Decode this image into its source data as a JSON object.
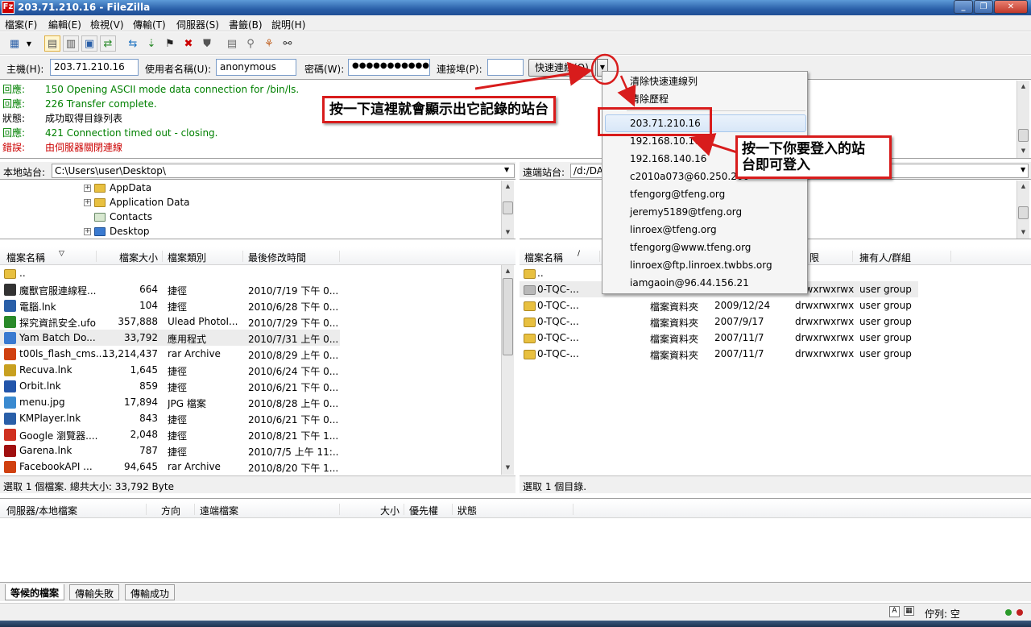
{
  "window": {
    "title": "203.71.210.16 - FileZilla",
    "app_icon": "Fz"
  },
  "menu": [
    "檔案(F)",
    "編輯(E)",
    "檢視(V)",
    "傳輸(T)",
    "伺服器(S)",
    "書籤(B)",
    "說明(H)"
  ],
  "quickconnect": {
    "host_label": "主機(H):",
    "host": "203.71.210.16",
    "user_label": "使用者名稱(U):",
    "user": "anonymous",
    "pass_label": "密碼(W):",
    "pass": "●●●●●●●●●●●●●",
    "port_label": "連接埠(P):",
    "port": "",
    "button": "快速連線(Q)"
  },
  "log": [
    {
      "type": "回應:",
      "msg": "150 Opening ASCII mode data connection for /bin/ls.",
      "color": "#008000"
    },
    {
      "type": "回應:",
      "msg": "226 Transfer complete.",
      "color": "#008000"
    },
    {
      "type": "狀態:",
      "msg": "成功取得目錄列表",
      "color": "#000000"
    },
    {
      "type": "回應:",
      "msg": "421 Connection timed out - closing.",
      "color": "#008000"
    },
    {
      "type": "錯誤:",
      "msg": "由伺服器關閉連線",
      "color": "#cc0000"
    }
  ],
  "local": {
    "label": "本地站台:",
    "path": "C:\\Users\\user\\Desktop\\",
    "tree": [
      "AppData",
      "Application Data",
      "Contacts",
      "Desktop"
    ],
    "columns": [
      "檔案名稱",
      "檔案大小",
      "檔案類別",
      "最後修改時間"
    ],
    "files": [
      {
        "name": "..",
        "size": "",
        "type": "",
        "date": ""
      },
      {
        "name": "魔獸官服連線程...",
        "size": "664",
        "type": "捷徑",
        "date": "2010/7/19 下午 0..."
      },
      {
        "name": "電腦.lnk",
        "size": "104",
        "type": "捷徑",
        "date": "2010/6/28 下午 0..."
      },
      {
        "name": "探究資訊安全.ufo",
        "size": "357,888",
        "type": "Ulead PhotoI...",
        "date": "2010/7/29 下午 0..."
      },
      {
        "name": "Yam Batch Do...",
        "size": "33,792",
        "type": "應用程式",
        "date": "2010/7/31 上午 0..."
      },
      {
        "name": "t00ls_flash_cms....",
        "size": "13,214,437",
        "type": "rar Archive",
        "date": "2010/8/29 上午 0..."
      },
      {
        "name": "Recuva.lnk",
        "size": "1,645",
        "type": "捷徑",
        "date": "2010/6/24 下午 0..."
      },
      {
        "name": "Orbit.lnk",
        "size": "859",
        "type": "捷徑",
        "date": "2010/6/21 下午 0..."
      },
      {
        "name": "menu.jpg",
        "size": "17,894",
        "type": "JPG 檔案",
        "date": "2010/8/28 上午 0..."
      },
      {
        "name": "KMPlayer.lnk",
        "size": "843",
        "type": "捷徑",
        "date": "2010/6/21 下午 0..."
      },
      {
        "name": "Google 瀏覽器....",
        "size": "2,048",
        "type": "捷徑",
        "date": "2010/8/21 下午 1..."
      },
      {
        "name": "Garena.lnk",
        "size": "787",
        "type": "捷徑",
        "date": "2010/7/5 上午 11:..."
      },
      {
        "name": "FacebookAPI ...",
        "size": "94,645",
        "type": "rar Archive",
        "date": "2010/8/20 下午 1..."
      }
    ],
    "status": "選取 1 個檔案. 總共大小: 33,792 Byte"
  },
  "remote": {
    "label": "遠端站台:",
    "path": "/d:/DA",
    "columns": [
      "檔案名稱",
      "",
      "",
      "限",
      "擁有人/群組"
    ],
    "files": [
      {
        "name": "..",
        "type": "",
        "date": "",
        "perm": "",
        "owner": ""
      },
      {
        "name": "0-TQC-...",
        "type": "",
        "date": "",
        "perm": "drwxrwxrwx",
        "owner": "user group"
      },
      {
        "name": "0-TQC-...",
        "type": "檔案資料夾",
        "date": "2009/12/24",
        "perm": "drwxrwxrwx",
        "owner": "user group"
      },
      {
        "name": "0-TQC-...",
        "type": "檔案資料夾",
        "date": "2007/9/17",
        "perm": "drwxrwxrwx",
        "owner": "user group"
      },
      {
        "name": "0-TQC-...",
        "type": "檔案資料夾",
        "date": "2007/11/7",
        "perm": "drwxrwxrwx",
        "owner": "user group"
      },
      {
        "name": "0-TQC-...",
        "type": "檔案資料夾",
        "date": "2007/11/7",
        "perm": "drwxrwxrwx",
        "owner": "user group"
      }
    ],
    "status": "選取 1 個目錄."
  },
  "queue": {
    "columns": [
      "伺服器/本地檔案",
      "方向",
      "遠端檔案",
      "大小",
      "優先權",
      "狀態"
    ],
    "tabs": [
      "等候的檔案",
      "傳輸失敗",
      "傳輸成功"
    ]
  },
  "statusbar": {
    "queue": "佇列: 空"
  },
  "dropdown": {
    "clear": "清除快速連線列",
    "history": "清除歷程",
    "items": [
      "203.71.210.16",
      "192.168.10.16",
      "192.168.140.16",
      "c2010a073@60.250.200",
      "tfengorg@tfeng.org",
      "jeremy5189@tfeng.org",
      "linroex@tfeng.org",
      "tfengorg@www.tfeng.org",
      "linroex@ftp.linroex.twbbs.org",
      "iamgaoin@96.44.156.21"
    ]
  },
  "annotations": {
    "callout1": "按一下這裡就會顯示出它記錄的站台",
    "callout2_line1": "按一下你要登入的站",
    "callout2_line2": "台即可登入"
  },
  "colors": {
    "accent": "#d81c1c",
    "log_ok": "#008000",
    "log_err": "#cc0000",
    "titlebar": "#2a5fa8"
  }
}
